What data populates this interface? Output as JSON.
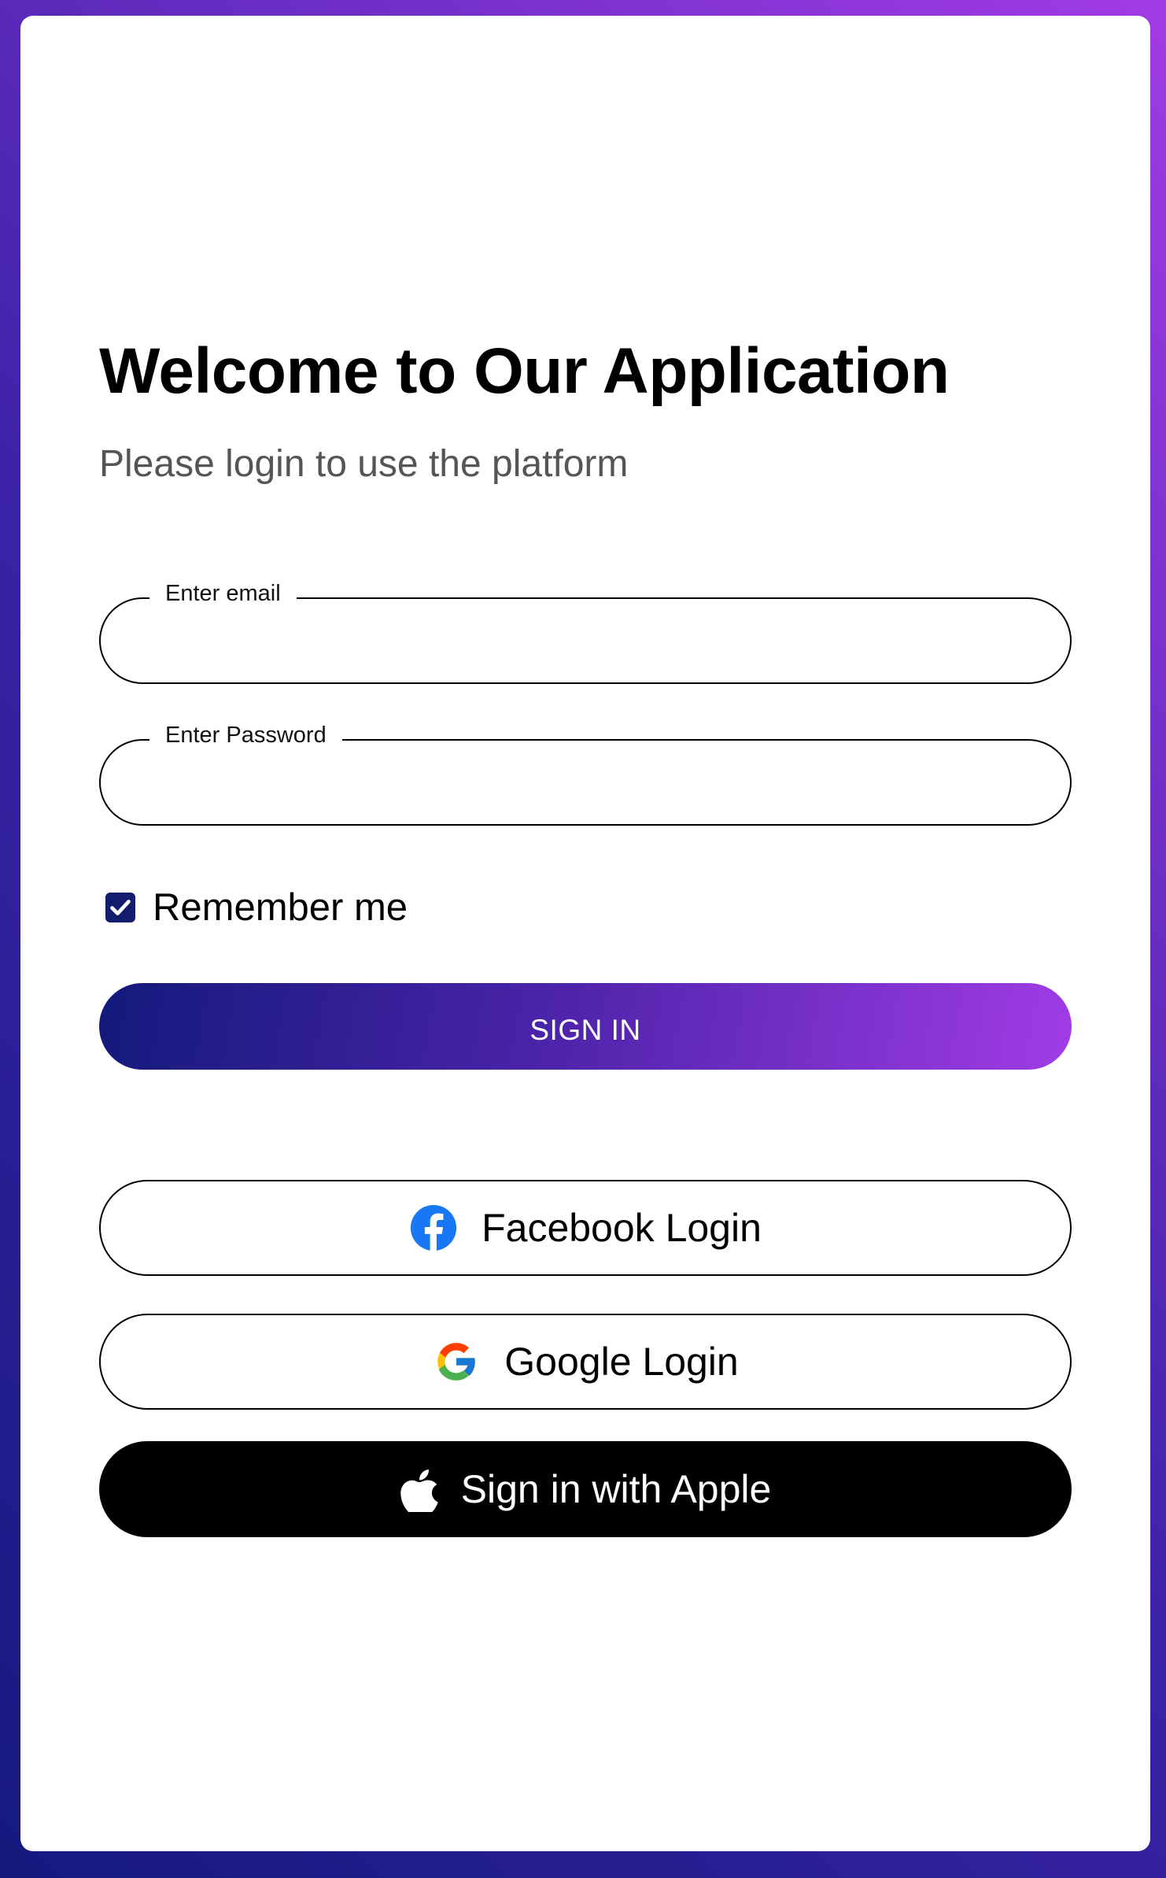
{
  "header": {
    "title": "Welcome to Our Application",
    "subtitle": "Please login to use the platform"
  },
  "form": {
    "email": {
      "label": "Enter email",
      "value": ""
    },
    "password": {
      "label": "Enter Password",
      "value": ""
    },
    "remember": {
      "label": "Remember me",
      "checked": true
    },
    "submit_label": "SIGN IN"
  },
  "social": {
    "facebook_label": "Facebook Login",
    "google_label": "Google Login",
    "apple_label": "Sign in with Apple"
  },
  "colors": {
    "primary_dark": "#141c6e",
    "accent_purple": "#a23be6",
    "facebook_blue": "#1877f2"
  },
  "icons": {
    "checkbox": "check-icon",
    "facebook": "facebook-icon",
    "google": "google-icon",
    "apple": "apple-icon"
  }
}
